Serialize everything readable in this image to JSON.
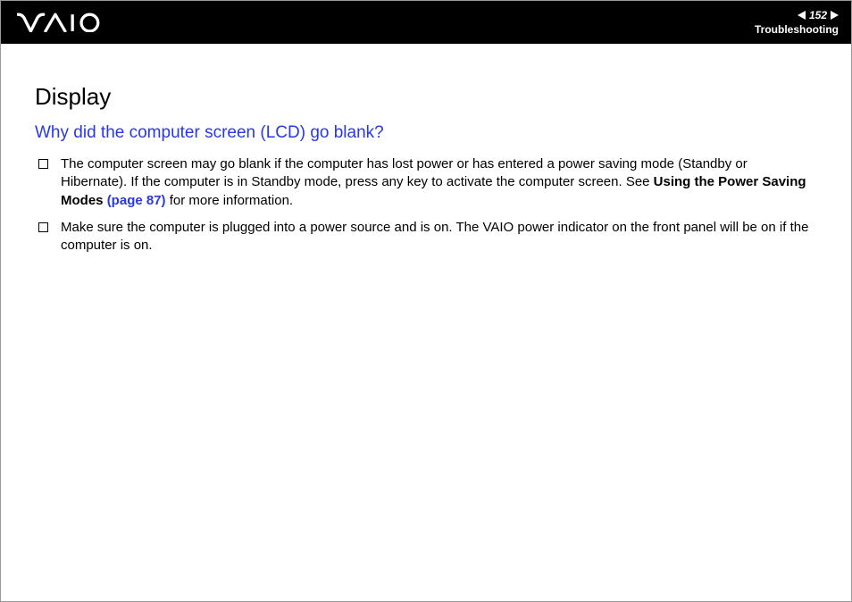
{
  "header": {
    "page_number": "152",
    "section": "Troubleshooting"
  },
  "content": {
    "title": "Display",
    "subtitle": "Why did the computer screen (LCD) go blank?",
    "items": [
      {
        "pre": "The computer screen may go blank if the computer has lost power or has entered a power saving mode (Standby or Hibernate). If the computer is in Standby mode, press any key to activate the computer screen. See ",
        "bold": "Using the Power Saving Modes",
        "link": "(page 87)",
        "post": " for more information."
      },
      {
        "pre": "Make sure the computer is plugged into a power source and is on. The VAIO power indicator on the front panel will be on if the computer is on."
      }
    ]
  }
}
